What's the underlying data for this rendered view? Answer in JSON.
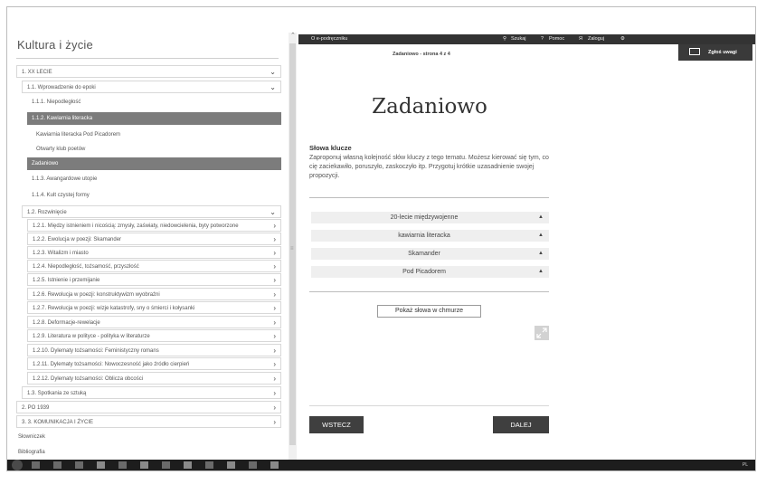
{
  "app": {
    "title": "Kultura i życie"
  },
  "toc": [
    {
      "label": "1. XX LECIE",
      "chevron": "⌄",
      "style": "bordered"
    },
    {
      "label": "1.1. Wprowadzenie do epoki",
      "chevron": "⌄",
      "style": "bordered"
    },
    {
      "label": "1.1.1. Niepodległość",
      "chevron": "",
      "style": "plain"
    },
    {
      "label": "1.1.2. Kawiarnia literacka",
      "chevron": "",
      "style": "active"
    },
    {
      "label": "Kawiarnia literacka Pod Picadorem",
      "chevron": "",
      "style": "plain"
    },
    {
      "label": "Otwarty klub poetów",
      "chevron": "",
      "style": "plain"
    },
    {
      "label": "Zadaniowo",
      "chevron": "",
      "style": "active"
    },
    {
      "label": "1.1.3. Awangardowe utopie",
      "chevron": "",
      "style": "plain"
    },
    {
      "label": "1.1.4. Kult czystej formy",
      "chevron": "",
      "style": "plain"
    },
    {
      "label": "1.2. Rozwinięcie",
      "chevron": "⌄",
      "style": "bordered"
    },
    {
      "label": "1.2.1. Między istnieniem i nicością: zmysły, zaświaty, niedowcielenia, byty potworzone",
      "chevron": "›",
      "style": "bordered"
    },
    {
      "label": "1.2.2. Ewolucja w poezji: Skamander",
      "chevron": "›",
      "style": "bordered"
    },
    {
      "label": "1.2.3. Witalizm i miasto",
      "chevron": "›",
      "style": "bordered"
    },
    {
      "label": "1.2.4. Niepodległość, tożsamość, przyszłość",
      "chevron": "›",
      "style": "bordered"
    },
    {
      "label": "1.2.5. Istnienie i przemijanie",
      "chevron": "›",
      "style": "bordered"
    },
    {
      "label": "1.2.6. Rewolucja w poezji: konstruktywizm wyobraźni",
      "chevron": "›",
      "style": "bordered"
    },
    {
      "label": "1.2.7. Rewolucja w poezji: wizje katastrofy, sny o śmierci i kołysanki",
      "chevron": "›",
      "style": "bordered"
    },
    {
      "label": "1.2.8. Deformacje-rewelacje",
      "chevron": "›",
      "style": "bordered"
    },
    {
      "label": "1.2.9. Literatura w polityce - polityka w literaturze",
      "chevron": "›",
      "style": "bordered"
    },
    {
      "label": "1.2.10. Dylematy tożsamości: Feministyczny romans",
      "chevron": "›",
      "style": "bordered"
    },
    {
      "label": "1.2.11. Dylematy tożsamości: Nowoczesność jako źródło cierpień",
      "chevron": "›",
      "style": "bordered"
    },
    {
      "label": "1.2.12. Dylematy tożsamości: Oblicza obcości",
      "chevron": "›",
      "style": "bordered"
    },
    {
      "label": "1.3. Spotkania ze sztuką",
      "chevron": "›",
      "style": "bordered"
    },
    {
      "label": "2. PO 1939",
      "chevron": "›",
      "style": "bordered"
    },
    {
      "label": "3. 3. KOMUNIKACJA I ŻYCIE",
      "chevron": "›",
      "style": "bordered"
    },
    {
      "label": "Słowniczek",
      "chevron": "",
      "style": "plain"
    },
    {
      "label": "Bibliografia",
      "chevron": "",
      "style": "plain"
    }
  ],
  "topbar": {
    "about": "O e-podręczniku",
    "search": "Szukaj",
    "help": "Pomoc",
    "login": "Zaloguj",
    "search_icon": "search-icon",
    "help_icon": "question-icon",
    "login_icon": "user-icon",
    "settings_icon": "gear-icon"
  },
  "page": {
    "indicator": "Zadaniowo - strona 4 z 4",
    "report_label": "Zgłoś uwagi",
    "title": "Zadaniowo",
    "keywords_heading": "Słowa klucze",
    "keywords_desc": "Zaproponuj własną kolejność słów kluczy z tego tematu. Możesz kierować się tym, co cię zaciekawiło, poruszyło, zaskoczyło itp. Przygotuj krótkie uzasadnienie swojej propozycji.",
    "selects": [
      {
        "value": "20-lecie międzywojenne"
      },
      {
        "value": "kawiarnia literacka"
      },
      {
        "value": "Skamander"
      },
      {
        "value": "Pod Picadorem"
      }
    ],
    "cloud_button": "Pokaż słowa w chmurze",
    "back_button": "WSTECZ",
    "next_button": "DALEJ"
  },
  "taskbar": {
    "tray": "PL"
  },
  "colors": {
    "active_row": "#7c7c7c",
    "dark_bar": "#333333",
    "button": "#3f3f3f"
  }
}
